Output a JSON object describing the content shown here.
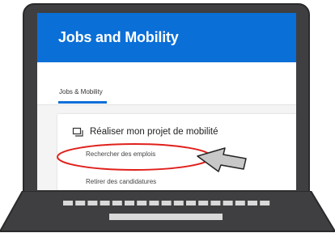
{
  "app": {
    "title": "Jobs and Mobility"
  },
  "tabs": [
    {
      "label": "Jobs & Mobility"
    }
  ],
  "card": {
    "title": "Réaliser mon projet de mobilité",
    "links": [
      {
        "label": "Rechercher des emplois"
      },
      {
        "label": "Retirer des candidatures"
      }
    ]
  },
  "icons": {
    "card_icon": "copy-icon",
    "pointer": "arrow-cursor-icon"
  },
  "colors": {
    "header": "#0a6fd7",
    "laptop": "#3f3f41",
    "highlight": "#e0201b"
  }
}
